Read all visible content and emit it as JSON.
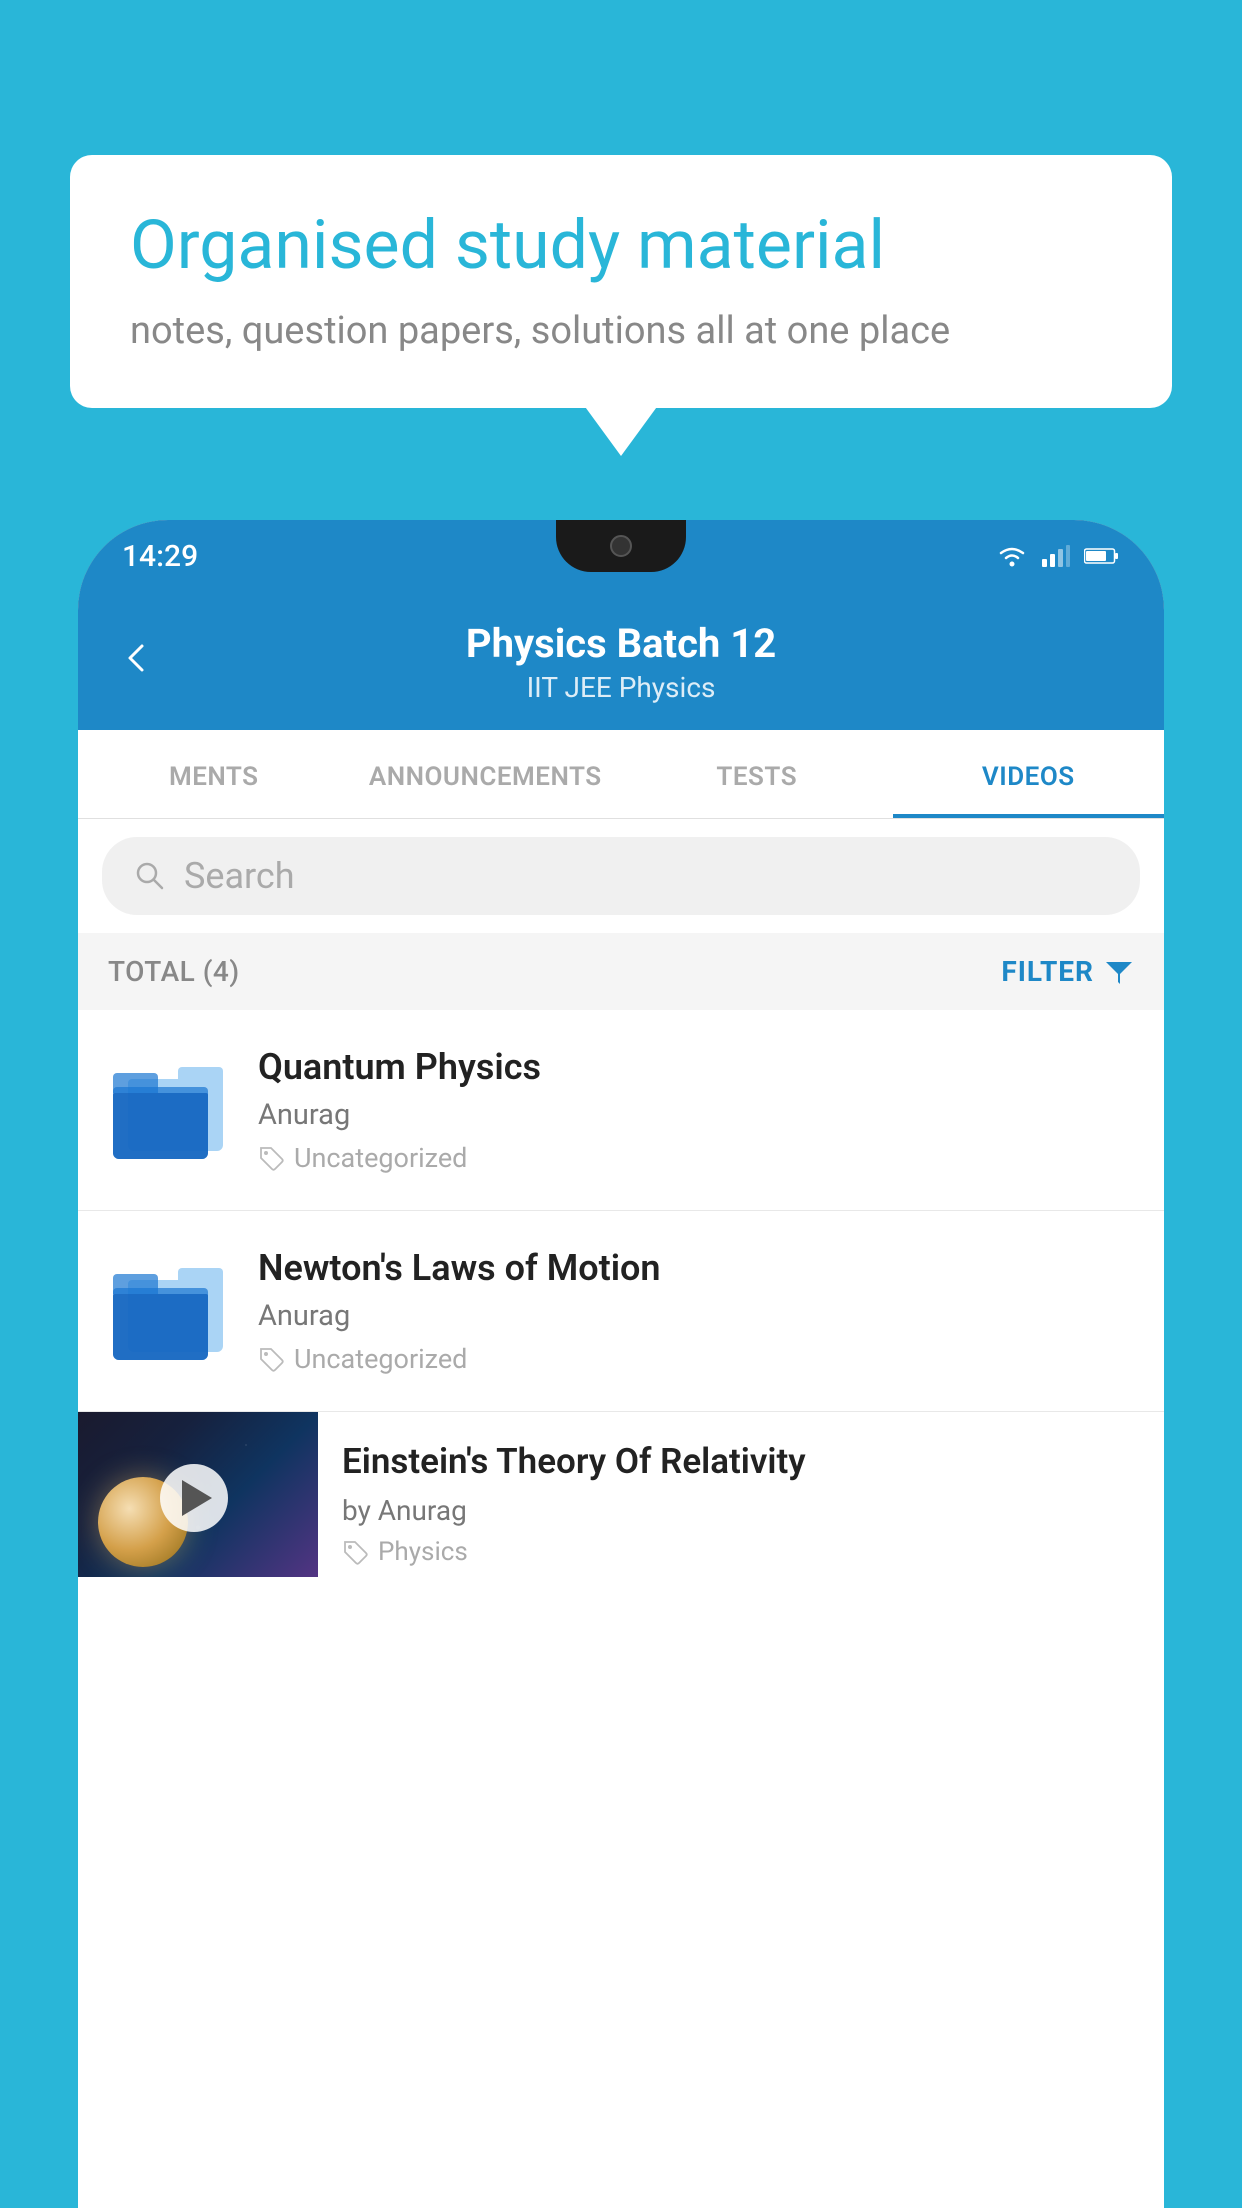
{
  "background_color": "#29b6d8",
  "bubble": {
    "title": "Organised study material",
    "subtitle": "notes, question papers, solutions all at one place"
  },
  "phone": {
    "status_bar": {
      "time": "14:29"
    },
    "header": {
      "title": "Physics Batch 12",
      "subtitle": "IIT JEE   Physics",
      "back_label": "←"
    },
    "tabs": [
      {
        "label": "MENTS",
        "active": false
      },
      {
        "label": "ANNOUNCEMENTS",
        "active": false
      },
      {
        "label": "TESTS",
        "active": false
      },
      {
        "label": "VIDEOS",
        "active": true
      }
    ],
    "search": {
      "placeholder": "Search"
    },
    "filter": {
      "total_label": "TOTAL (4)",
      "filter_label": "FILTER"
    },
    "videos": [
      {
        "id": "quantum",
        "title": "Quantum Physics",
        "author": "Anurag",
        "tag": "Uncategorized",
        "has_thumb": false
      },
      {
        "id": "newton",
        "title": "Newton's Laws of Motion",
        "author": "Anurag",
        "tag": "Uncategorized",
        "has_thumb": false
      },
      {
        "id": "einstein",
        "title": "Einstein's Theory Of Relativity",
        "author": "by Anurag",
        "tag": "Physics",
        "has_thumb": true
      }
    ]
  }
}
